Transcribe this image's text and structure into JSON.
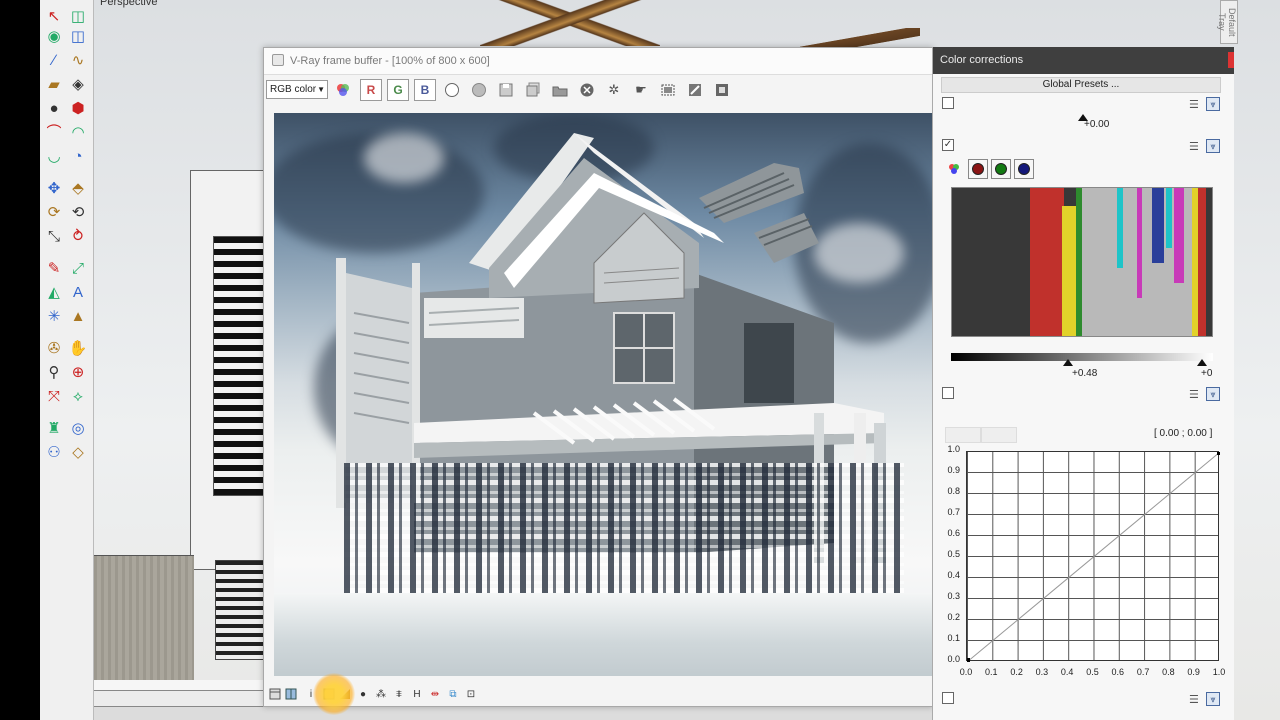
{
  "viewport": {
    "label": "Perspective",
    "tray_label": "Default Tray"
  },
  "toolbar": {
    "rows": [
      [
        "select-icon",
        "eraser-icon"
      ],
      [
        "paint-bucket-icon",
        "eraser-icon"
      ],
      [
        "line-icon",
        "freehand-icon"
      ],
      [
        "rectangle-icon",
        "rotated-rectangle-icon"
      ],
      [
        "circle-icon",
        "polygon-icon"
      ],
      [
        "arc-icon",
        "two-point-arc-icon"
      ],
      [
        "three-point-arc-icon",
        "pie-icon"
      ],
      [
        "move-icon",
        "push-pull-icon"
      ],
      [
        "rotate-icon",
        "follow-me-icon"
      ],
      [
        "scale-icon",
        "offset-icon"
      ],
      [
        "tape-measure-icon",
        "dimension-icon"
      ],
      [
        "protractor-icon",
        "text-icon"
      ],
      [
        "axes-icon",
        "3d-text-icon"
      ],
      [
        "orbit-icon",
        "pan-icon"
      ],
      [
        "zoom-icon",
        "zoom-window-icon"
      ],
      [
        "zoom-extents-icon",
        "previous-view-icon"
      ],
      [
        "position-camera-icon",
        "look-around-icon"
      ],
      [
        "walk-icon",
        "section-plane-icon"
      ]
    ]
  },
  "vfb": {
    "title": "V-Ray frame buffer - [100% of 800 x 600]",
    "channel": "RGB color",
    "btn_r": "R",
    "btn_g": "G",
    "btn_b": "B"
  },
  "cc": {
    "title": "Color corrections",
    "global_presets": "Global Presets ...",
    "exposure_value": "+0.00",
    "level_low": "+0.48",
    "level_high": "+0",
    "curve_readout": "[ 0.00 ; 0.00 ]",
    "y_ticks": [
      "1.0",
      "0.9",
      "0.8",
      "0.7",
      "0.6",
      "0.5",
      "0.4",
      "0.3",
      "0.2",
      "0.1",
      "0.0"
    ],
    "x_ticks": [
      "0.0",
      "0.1",
      "0.2",
      "0.3",
      "0.4",
      "0.5",
      "0.6",
      "0.7",
      "0.8",
      "0.9",
      "1.0"
    ],
    "check_mark": "✓"
  },
  "colors": {
    "red": "#c0312c",
    "green": "#2e8b2e",
    "blue": "#2a3f9a",
    "yellow": "#e2d22a",
    "cyan": "#1ec4c8",
    "magenta": "#c83ab8"
  }
}
